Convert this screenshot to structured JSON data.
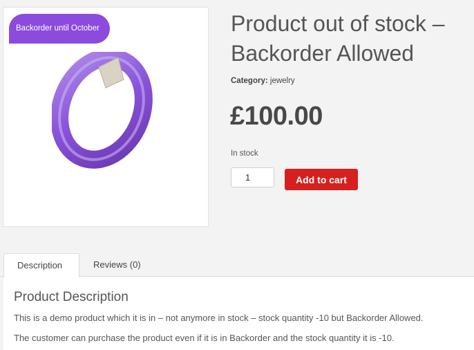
{
  "product": {
    "badge": "Backorder until October",
    "title": "Product out of stock – Backorder Allowed",
    "category_label": "Category:",
    "category_value": "jewelry",
    "price": "£100.00",
    "stock_status": "In stock",
    "quantity": "1",
    "add_to_cart_label": "Add to cart",
    "image_icon": "purple-ring-image"
  },
  "tabs": [
    {
      "label": "Description",
      "active": true
    },
    {
      "label": "Reviews (0)",
      "active": false
    }
  ],
  "description": {
    "heading": "Product Description",
    "paragraphs": [
      "This is a demo product which it is in – not anymore in stock – stock quantity -10 but Backorder Allowed.",
      "The customer can purchase the product even if it is in Backorder and the stock quantity it is -10."
    ]
  },
  "colors": {
    "badge": "#8c4bdc",
    "add_to_cart": "#d5201f",
    "ring": "#7b3fd6"
  }
}
